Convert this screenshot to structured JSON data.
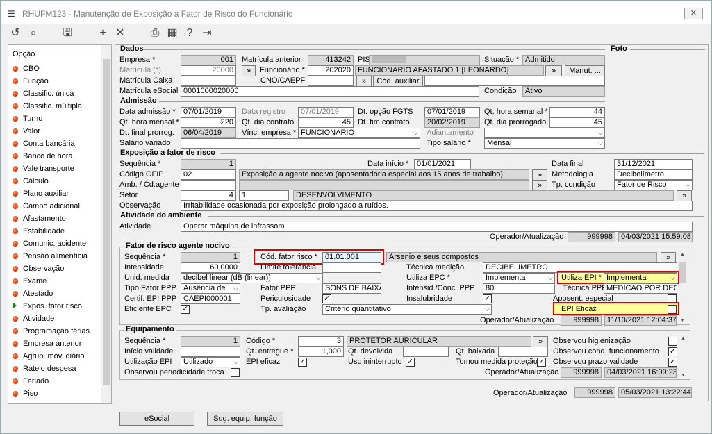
{
  "window": {
    "title": "RHUFM123 - Manutenção de Exposição a Fator de Risco do Funcionário",
    "close": "✕"
  },
  "toolbar": {
    "icons": [
      "undo-icon",
      "search-icon",
      "save-icon",
      "add-icon",
      "delete-icon",
      "print-icon",
      "calendar-icon",
      "help-icon",
      "exit-icon"
    ]
  },
  "sidebar": {
    "header": "Opção",
    "items": [
      "CBO",
      "Função",
      "Classific. única",
      "Classific. múltipla",
      "Turno",
      "Valor",
      "Conta bancária",
      "Banco de hora",
      "Vale transporte",
      "Cálculo",
      "Plano auxiliar",
      "Campo adicional",
      "Afastamento",
      "Estabilidade",
      "Comunic. acidente",
      "Pensão alimentícia",
      "Observação",
      "Exame",
      "Atestado",
      "Expos. fator risco",
      "Atividade",
      "Programação férias",
      "Empresa anterior",
      "Agrup. mov. diário",
      "Rateio despesa",
      "Feriado",
      "Piso"
    ],
    "selected_index": 19
  },
  "dados": {
    "section": "Dados",
    "foto": "Foto",
    "empresa_label": "Empresa *",
    "empresa": "001",
    "matricula_ant_label": "Matrícula anterior",
    "matricula_ant": "413242",
    "pis_label": "PIS",
    "situacao_label": "Situação *",
    "situacao": "Admitido",
    "matricula_label": "Matrícula (*)",
    "matricula": "20000",
    "funcionario_label": "Funcionário *",
    "funcionario_cod": "202020",
    "funcionario_nome": "FUNCIONARIO AFASTADO 1 [LEONARDO]",
    "manut": "Manut. ...",
    "caixa_label": "Matrícula Caixa",
    "cno_label": "CNO/CAEPF",
    "cod_aux": "Cód. auxiliar",
    "esocial_label": "Matrícula eSocial",
    "esocial": "0001000020000",
    "condicao_label": "Condição",
    "condicao": "Ativo"
  },
  "admissao": {
    "section": "Admissão",
    "data_adm_label": "Data admissão *",
    "data_adm": "07/01/2019",
    "data_reg_label": "Data registro",
    "data_reg": "07/01/2019",
    "dt_fgts_label": "Dt. opção FGTS",
    "dt_fgts": "07/01/2019",
    "qt_sem_label": "Qt. hora semanal *",
    "qt_sem": "44",
    "qt_mensal_label": "Qt. hora mensal *",
    "qt_mensal": "220",
    "qt_contrato_label": "Qt. dia contrato",
    "qt_contrato": "45",
    "dt_fim_label": "Dt. fim contrato",
    "dt_fim": "20/02/2019",
    "qt_prorr_label": "Qt. dia prorrogado",
    "qt_prorr": "45",
    "dt_final_label": "Dt. final prorrog.",
    "dt_final": "06/04/2019",
    "vinc_label": "Vínc. empresa *",
    "vinc": "FUNCIONARIO",
    "adiant_label": "Adiantamento",
    "salario_var_label": "Salário variado",
    "tipo_sal_label": "Tipo salário *",
    "tipo_sal": "Mensal"
  },
  "exposicao": {
    "section": "Exposição a fator de risco",
    "seq_label": "Sequência *",
    "seq": "1",
    "data_ini_label": "Data início *",
    "data_ini": "01/01/2021",
    "data_final_label": "Data final",
    "data_final": "31/12/2021",
    "gfip_label": "Código GFIP",
    "gfip": "02",
    "gfip_desc": "Exposição a agente nocivo (aposentadoria especial aos 15 anos de trabalho)",
    "metodologia_label": "Metodologia",
    "metodologia": "Decibelímetro",
    "amb_label": "Amb. / Cd.agente",
    "tp_cond_label": "Tp. condição",
    "tp_cond": "Fator de Risco",
    "setor_label": "Setor",
    "setor": "4",
    "setor2": "1",
    "setor_desc": "DESENVOLVIMENTO",
    "obs_label": "Observação",
    "obs": "Irritabilidade ocasionada por exposição prolongado a ruídos."
  },
  "ambiente": {
    "section": "Atividade do ambiente",
    "ativ_label": "Atividade",
    "ativ": "Operar máquina de infrassom",
    "op_label": "Operador/Atualização",
    "op": "999998",
    "op_dt": "04/03/2021 15:59:08"
  },
  "fator": {
    "section": "Fator de risco agente nocivo",
    "seq_label": "Sequência *",
    "seq": "1",
    "cod_label": "Cód. fator risco *",
    "cod": "01.01.001",
    "cod_desc": "Arsenio e seus compostos",
    "intens_label": "Intensidade",
    "intens": "60,0000",
    "limite_label": "Limite tolerância",
    "tec_label": "Técnica medição",
    "tec": "DECIBELIMETRO",
    "unid_label": "Unid. medida",
    "unid": "decibel linear (dB (linear))",
    "epc_label": "Utiliza EPC *",
    "epc": "Implementa",
    "epi_label": "Utiliza EPI *",
    "epi": "Implementa",
    "tipo_ppp_label": "Tipo Fator PPP",
    "tipo_ppp": "Ausência de",
    "fator_ppp_label": "Fator PPP",
    "fator_ppp": "SONS DE BAIXA",
    "intensid_label": "Intensid./Conc. PPP",
    "intensid": "80",
    "tec_ppp_label": "Técnica PPP",
    "tec_ppp": "MEDICAO POR DECIB",
    "certif_label": "Certif. EPI PPP",
    "certif": "CAEPI000001",
    "peric_label": "Periculosidade",
    "insal_label": "Insalubridade",
    "apos_label": "Aposent. especial",
    "efic_epc_label": "Eficiente EPC",
    "tp_aval_label": "Tp. avaliação",
    "tp_aval": "Critério quantitativo",
    "epi_efic_label": "EPI Eficaz",
    "op_label": "Operador/Atualização",
    "op": "999998",
    "op_dt": "11/10/2021 12:04:37"
  },
  "equip": {
    "section": "Equipamento",
    "seq_label": "Sequência *",
    "seq": "1",
    "cod_label": "Código *",
    "cod": "3",
    "cod_desc": "PROTETOR AURICULAR",
    "obs_hig_label": "Observou higienização",
    "ini_label": "Início validade",
    "qt_ent_label": "Qt. entregue *",
    "qt_ent": "1,000",
    "qt_dev_label": "Qt. devolvida",
    "qt_baix_label": "Qt. baixada",
    "obs_func_label": "Observou cond. funcionamento",
    "util_label": "Utilização EPI",
    "util": "Utilizado",
    "epi_ef_label": "EPI eficaz",
    "uso_label": "Uso ininterrupto",
    "tomou_label": "Tomou medida proteção",
    "obs_prazo_label": "Observou prazo validade",
    "obs_per_label": "Observou periodicidade troca",
    "op_label": "Operador/Atualização",
    "op": "999998",
    "op_dt": "04/03/2021 16:09:23"
  },
  "footer": {
    "op_label": "Operador/Atualização",
    "op": "999998",
    "op_dt": "05/03/2021 13:22:44",
    "esocial_btn": "eSocial",
    "sug_btn": "Sug. equip. função"
  }
}
